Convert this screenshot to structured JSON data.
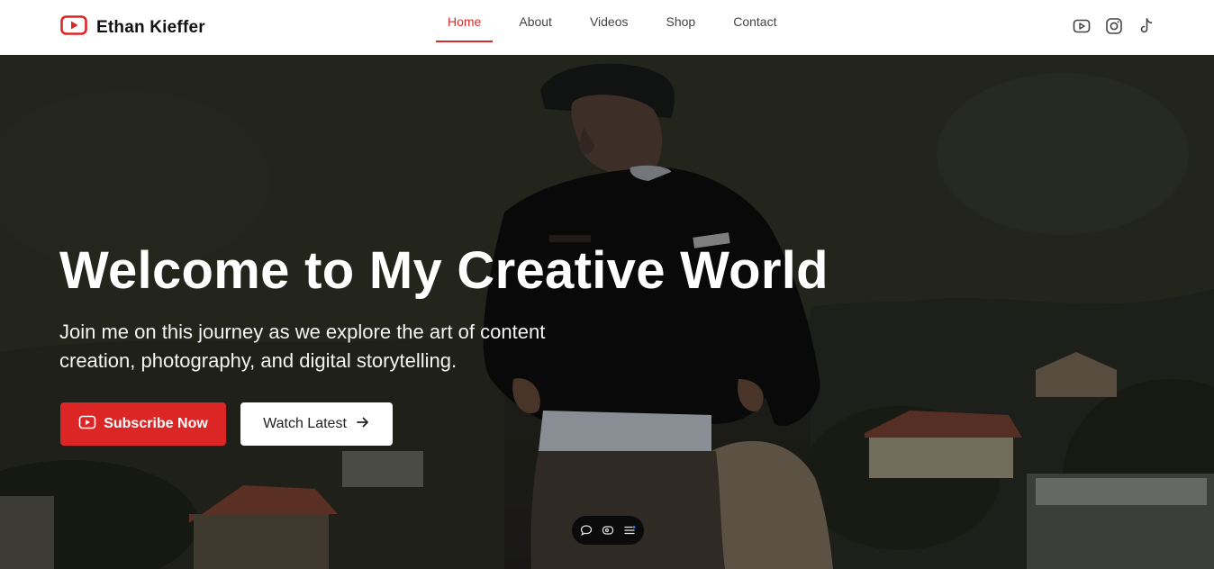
{
  "brand": {
    "name": "Ethan Kieffer",
    "icon": "youtube-icon",
    "accent": "#dc2626"
  },
  "nav": {
    "items": [
      {
        "label": "Home",
        "active": true
      },
      {
        "label": "About",
        "active": false
      },
      {
        "label": "Videos",
        "active": false
      },
      {
        "label": "Shop",
        "active": false
      },
      {
        "label": "Contact",
        "active": false
      }
    ]
  },
  "social": {
    "icons": [
      "youtube-icon",
      "instagram-icon",
      "tiktok-icon"
    ]
  },
  "hero": {
    "title": "Welcome to My Creative World",
    "subtitle": "Join me on this journey as we explore the art of content creation, photography, and digital storytelling.",
    "primary_button": "Subscribe Now",
    "secondary_button": "Watch Latest"
  },
  "floating_toolbar": {
    "icons": [
      "chat-icon",
      "eye-icon",
      "menu-icon"
    ]
  }
}
